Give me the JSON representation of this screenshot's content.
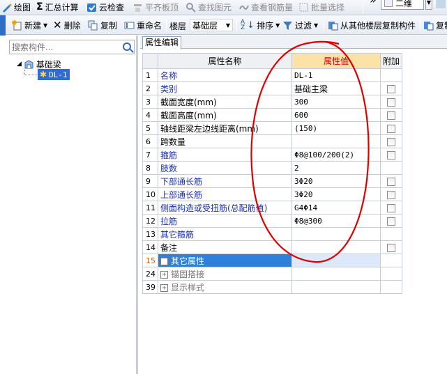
{
  "toolbar1": {
    "items": [
      "绘图",
      "汇总计算",
      "云检查",
      "平齐板顶",
      "查找图元",
      "查看钢筋量",
      "批量选择",
      "二维"
    ]
  },
  "toolbar2": {
    "new_label": "新建",
    "delete_label": "删除",
    "copy_label": "复制",
    "rename_label": "重命名",
    "floor_label": "楼层",
    "floor_value": "基础层",
    "sort_label": "排序",
    "filter_label": "过滤",
    "copy_from_floor_label": "从其他楼层复制构件",
    "copy_truncated_label": "复制"
  },
  "search": {
    "placeholder": "搜索构件..."
  },
  "tree": {
    "root_label": "基础梁",
    "child_label": "DL-1"
  },
  "tab": {
    "label": "属性编辑"
  },
  "grid": {
    "headers": {
      "name": "属性名称",
      "value": "属性值",
      "extra": "附加"
    },
    "rows": [
      {
        "num": "1",
        "name": "名称",
        "value": "DL-1"
      },
      {
        "num": "2",
        "name": "类别",
        "value": "基础主梁"
      },
      {
        "num": "3",
        "name": "截面宽度(mm)",
        "value": "300"
      },
      {
        "num": "4",
        "name": "截面高度(mm)",
        "value": "600"
      },
      {
        "num": "5",
        "name": "轴线距梁左边线距离(mm)",
        "value": "(150)"
      },
      {
        "num": "6",
        "name": "跨数量",
        "value": ""
      },
      {
        "num": "7",
        "name": "箍筋",
        "value": "Φ8@100/200(2)"
      },
      {
        "num": "8",
        "name": "肢数",
        "value": "2"
      },
      {
        "num": "9",
        "name": "下部通长筋",
        "value": "3Φ20"
      },
      {
        "num": "10",
        "name": "上部通长筋",
        "value": "3Φ20"
      },
      {
        "num": "11",
        "name": "侧面构造或受扭筋(总配筋值)",
        "value": "G4Φ14"
      },
      {
        "num": "12",
        "name": "拉筋",
        "value": "Φ8@300"
      },
      {
        "num": "13",
        "name": "其它箍筋",
        "value": ""
      },
      {
        "num": "14",
        "name": "备注",
        "value": ""
      },
      {
        "num": "15",
        "name": "其它属性",
        "value": ""
      },
      {
        "num": "24",
        "name": "锚固搭接",
        "value": ""
      },
      {
        "num": "39",
        "name": "显示样式",
        "value": ""
      }
    ]
  },
  "colors": {
    "selection": "#2f80d8",
    "header_value_bg": "#fbe3a8",
    "annotation_circle": "#e00000",
    "label_blue": "#1a2db8"
  }
}
